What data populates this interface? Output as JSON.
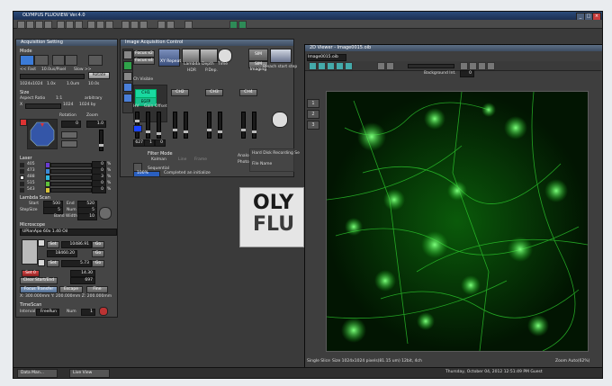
{
  "app": {
    "title": "OLYMPUS FLUOVIEW Ver.4.0"
  },
  "toolbar": {
    "icons": [
      "new-icon",
      "open-icon",
      "save-icon",
      "print-icon",
      "zoom-icon",
      "pan-icon",
      "roi-icon",
      "measure-icon",
      "chart-icon",
      "settings-icon"
    ]
  },
  "acquisition": {
    "title": "Acquisition Setting",
    "mode_label": "Mode",
    "fast_label": "<< Fast",
    "speed_label": "10.0us/Pixel",
    "slow_label": "Slow >>",
    "rotate_btn": "Rotate",
    "resolution": "1024x1024",
    "zoom_value": "1.0x",
    "step": "1.0um",
    "time_value": "10.0s",
    "size_label": "Size",
    "aspect_label": "Aspect Ratio",
    "aspect_value": "1:1",
    "arbitrary_label": "arbitrary",
    "x_label": "X",
    "x_value": "1024",
    "y_label": "1024 by",
    "rotation_label": "Rotation",
    "zoom_label": "Zoom",
    "rotation_value": "0",
    "zoom_field": "1.0",
    "laser_label": "Laser",
    "lasers": [
      {
        "name": "405",
        "value": "0",
        "unit": "%"
      },
      {
        "name": "473",
        "value": "0",
        "unit": "%"
      },
      {
        "name": "488",
        "value": "3",
        "unit": "%"
      },
      {
        "name": "515",
        "value": "0",
        "unit": "%"
      },
      {
        "name": "543",
        "value": "0",
        "unit": "%"
      }
    ],
    "lambda_label": "Lambda Scan",
    "start_label": "Start",
    "start_value": "500",
    "end_label": "End",
    "end_value": "520",
    "stepsize_label": "StepSize",
    "stepsize_value": "5",
    "num_label": "Num",
    "num_value": "5",
    "band_label": "Band Width",
    "band_value": "10",
    "microscope_label": "Microscope",
    "objective": "UPlanApo 60x 1.40 Oil",
    "mic_values": [
      "10486.91",
      "18460.20",
      "5.73"
    ],
    "set_label": "Set",
    "go_label": "Go",
    "zstep_value": "14.30",
    "slices_value": "697",
    "set0_label": "Set 0",
    "clear_btn": "Clear Start/End",
    "focus_btn": "Focus Transfer",
    "escape_btn": "Escape",
    "fine_label": "Fine",
    "stage_info": "X: 300.000mm Y: 200.000mm Z: 200.000mm",
    "timelapse_label": "TimeScan",
    "interval_label": "Interval",
    "interval_value": "FreeRun",
    "num2_label": "Num",
    "num2_value": "1"
  },
  "image_control": {
    "title": "Image Acquisition Control",
    "focus2": "Focus x2",
    "focus4": "Focus x4",
    "xy_repeat": "XY Repeat",
    "lambda": "Lambda",
    "depth": "Depth",
    "time": "Time",
    "hdr": "HDR",
    "pdep": "P.Dep.",
    "sim_label": "SIM LightPath",
    "sim_imaging": "SIM Imaging",
    "bleach": "Bleach start step",
    "ch_visible": "Ch Visible",
    "ch1": "CH1",
    "ch1_alt": "CH1",
    "ch2": "CH2",
    "ch3": "CH3",
    "ch4": "CH4",
    "ch_active": "EGFP",
    "col_heads": [
      "HV",
      "Gain",
      "Offset"
    ],
    "hv_values": [
      "627",
      "1",
      "0"
    ],
    "filter_mode": "Filter Mode",
    "kalman": "Kalman",
    "line": "Line",
    "frame": "Frame",
    "analog": "Analog Int",
    "photon": "Photon Cnt",
    "sequential": "Sequential",
    "progress": "100%",
    "completed": "Completed an initialize",
    "hard_disk": "Hard Disk Recording Se",
    "file_name": "File Name"
  },
  "image_window": {
    "title": "2D Viewer - Image0015.oib",
    "tab": "Image0015.oib",
    "background": "Background Int.",
    "bg_value": "0",
    "side_nums": [
      "1",
      "2",
      "3"
    ],
    "single": "Single Slice",
    "size_info": "Size 1024x1024 pixels(81.15 um) 12bit, 4ch",
    "zoom_status": "Zoom Auto(62%)"
  },
  "logo": {
    "line1": "OLY",
    "line2": "FLU"
  },
  "taskbar": {
    "items": [
      "Data Man...",
      "Live View"
    ],
    "clock": "Thursday, October 04, 2012 12:51:49 PM  Guest"
  },
  "colors": {
    "accent": "#19d9a0",
    "signal": "#22ff22"
  }
}
